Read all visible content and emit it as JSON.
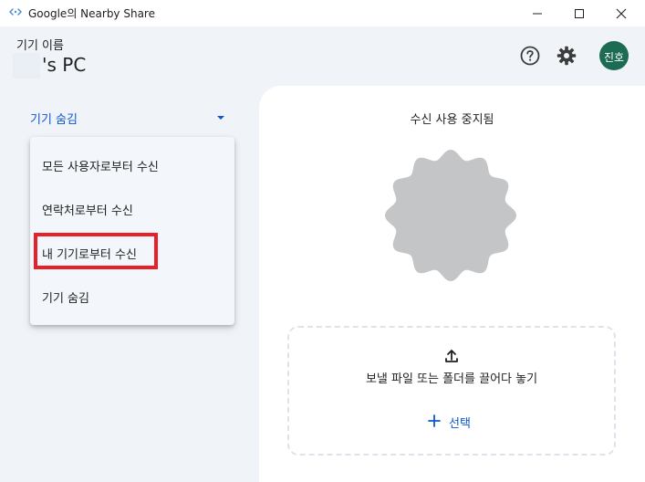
{
  "window": {
    "title": "Google의 Nearby Share",
    "logo_icon": "nearby-share-logo-icon",
    "controls": [
      "minimize-icon",
      "maximize-icon",
      "close-icon"
    ]
  },
  "header": {
    "device_label": "기기 이름",
    "device_name": "'s PC",
    "help_icon": "help-circle-icon",
    "settings_icon": "gear-icon",
    "avatar_text": "진호",
    "avatar_color": "#1d6b52"
  },
  "visibility": {
    "selected": "기기 숨김",
    "accent_color": "#0b57d0",
    "options": [
      "모든 사용자로부터 수신",
      "연락처로부터 수신",
      "내 기기로부터 수신",
      "기기 숨김"
    ],
    "highlighted_option_index": 2,
    "highlight_color": "#e8202a"
  },
  "main": {
    "status": "수신 사용 중지됨",
    "badge_color": "#c4c5c6",
    "drop_zone_text": "보낼 파일 또는 폴더를 끌어다 놓기",
    "upload_icon": "upload-icon",
    "select_label": "선택",
    "select_icon": "plus-icon"
  }
}
